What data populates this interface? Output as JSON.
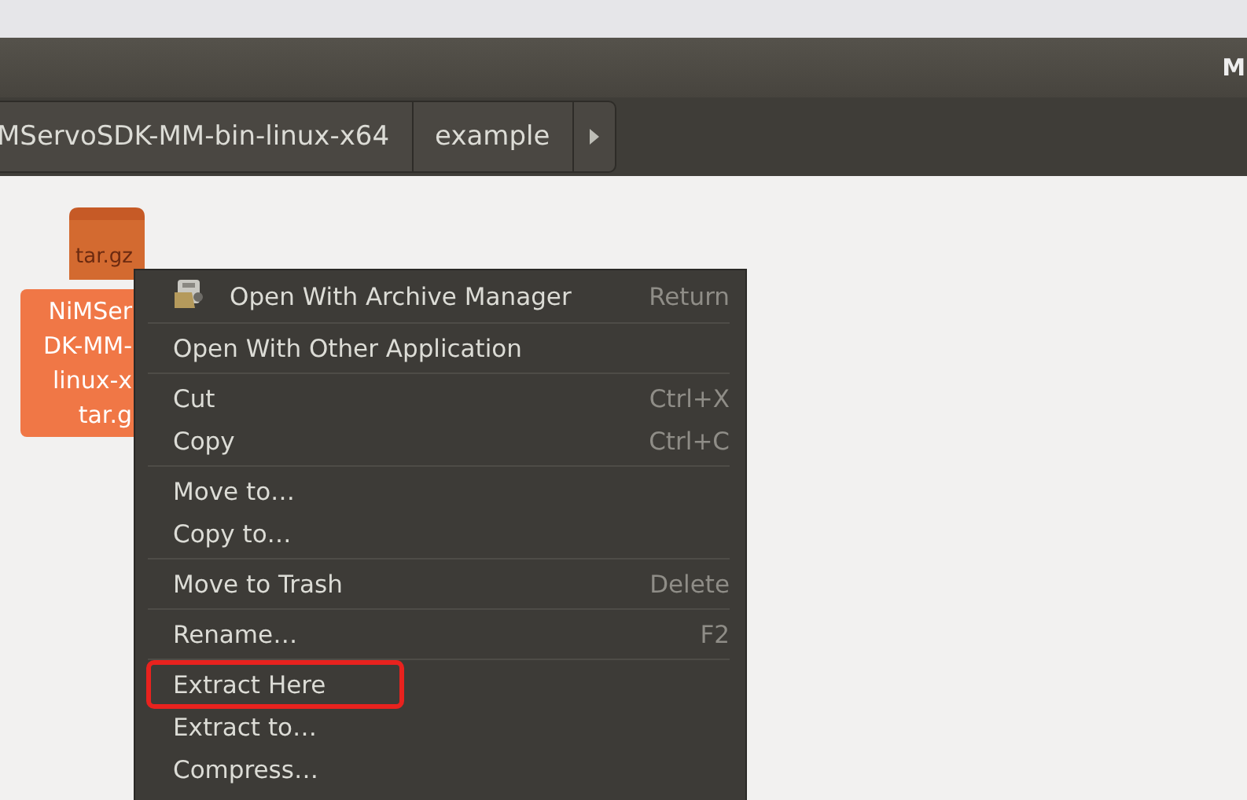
{
  "window": {
    "title": "M"
  },
  "breadcrumbs": [
    {
      "label": "MServoSDK-MM-bin-linux-x64"
    },
    {
      "label": "example"
    }
  ],
  "file": {
    "type_label": "tar.gz",
    "name_lines": [
      "NiMSer",
      "DK-MM-",
      "linux-x",
      "tar.g"
    ],
    "selected": true
  },
  "context_menu": {
    "items": [
      {
        "kind": "item",
        "label": "Open With Archive Manager",
        "shortcut": "Return",
        "icon": true,
        "highlighted": false
      },
      {
        "kind": "separator"
      },
      {
        "kind": "item",
        "label": "Open With Other Application",
        "highlighted": false
      },
      {
        "kind": "separator"
      },
      {
        "kind": "item",
        "label": "Cut",
        "shortcut": "Ctrl+X",
        "highlighted": false
      },
      {
        "kind": "item",
        "label": "Copy",
        "shortcut": "Ctrl+C",
        "highlighted": false
      },
      {
        "kind": "separator"
      },
      {
        "kind": "item",
        "label": "Move to…",
        "highlighted": false
      },
      {
        "kind": "item",
        "label": "Copy to…",
        "highlighted": false
      },
      {
        "kind": "separator"
      },
      {
        "kind": "item",
        "label": "Move to Trash",
        "shortcut": "Delete",
        "highlighted": false
      },
      {
        "kind": "separator"
      },
      {
        "kind": "item",
        "label": "Rename…",
        "shortcut": "F2",
        "highlighted": false
      },
      {
        "kind": "separator"
      },
      {
        "kind": "item",
        "label": "Extract Here",
        "highlighted": true
      },
      {
        "kind": "item",
        "label": "Extract to…",
        "highlighted": false
      },
      {
        "kind": "item",
        "label": "Compress…",
        "highlighted": false
      }
    ]
  }
}
